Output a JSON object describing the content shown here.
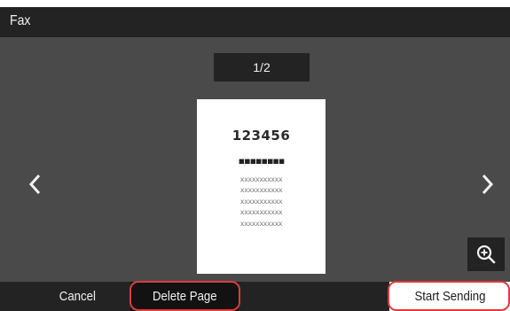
{
  "header": {
    "title": "Fax"
  },
  "preview": {
    "page_indicator": "1/2",
    "document": {
      "heading": "123456",
      "bullets": "▪▪▪▪▪▪▪▪",
      "lines": [
        "xxxxxxxxxxx",
        "xxxxxxxxxxx",
        "xxxxxxxxxxx",
        "xxxxxxxxxxx",
        "xxxxxxxxxxx"
      ]
    },
    "prev_icon": "chevron-left-icon",
    "next_icon": "chevron-right-icon",
    "zoom_icon": "zoom-in-icon"
  },
  "footer": {
    "cancel_label": "Cancel",
    "delete_label": "Delete Page",
    "start_label": "Start Sending"
  },
  "colors": {
    "background": "#4a4a4a",
    "bar": "#232323",
    "highlight": "#e03b3b"
  }
}
